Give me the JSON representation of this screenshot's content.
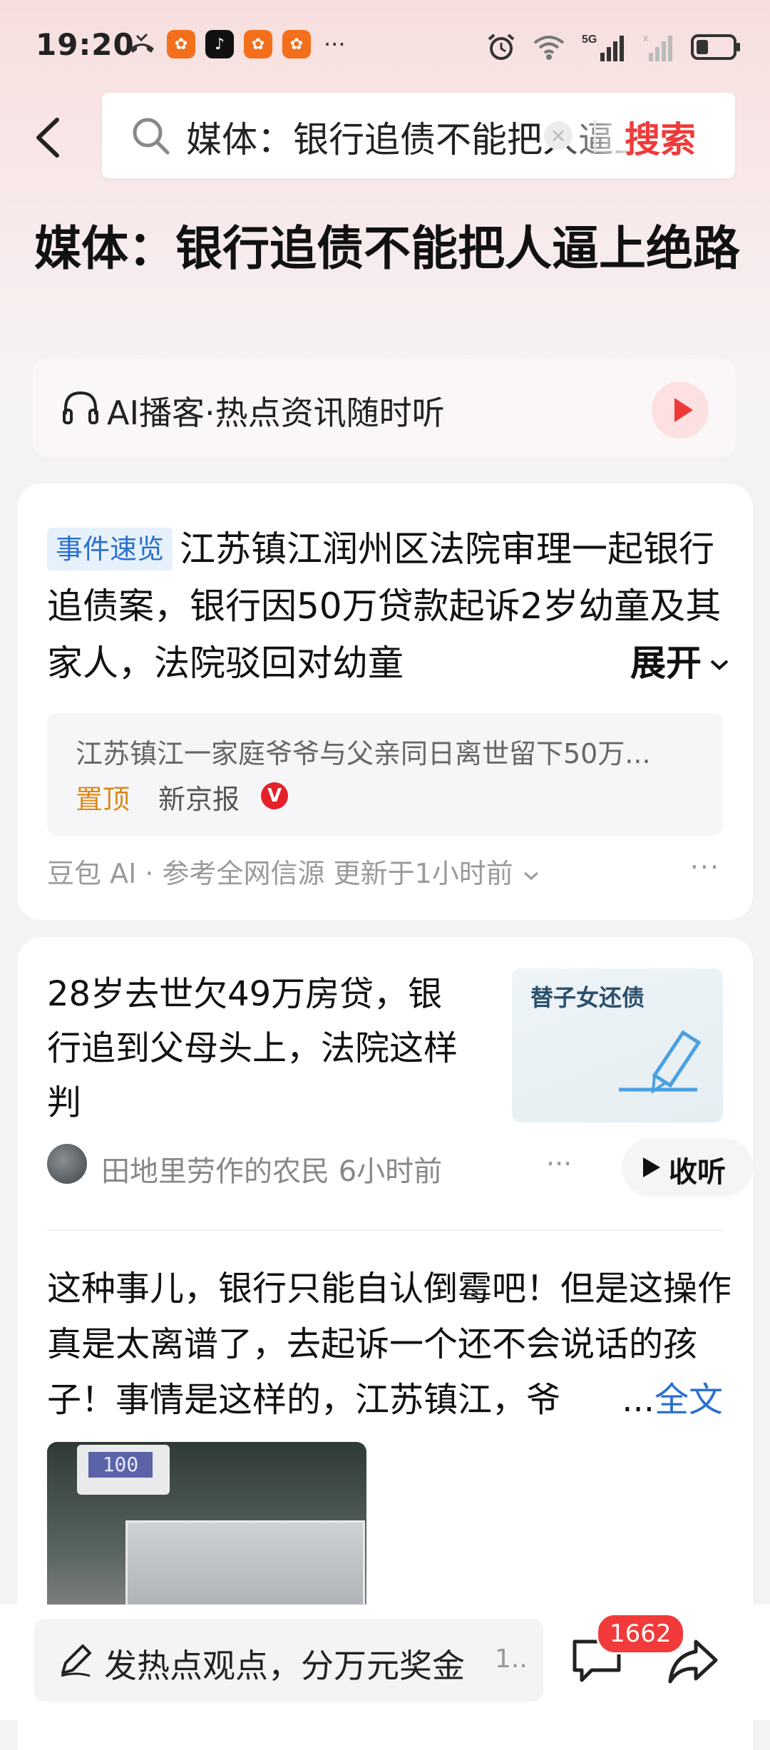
{
  "status_bar": {
    "time": "19:20",
    "icons": [
      "missed-call-icon",
      "app-icon",
      "tiktok-icon",
      "app-icon",
      "app-icon",
      "more-dots",
      "alarm-icon",
      "wifi-icon",
      "5g-signal-icon",
      "signal-icon",
      "battery-icon"
    ],
    "more": "···",
    "network": "5G"
  },
  "nav": {
    "search_query": "媒体：银行追债不能把人逼上绝路",
    "clear_label": "×",
    "search_button": "搜索"
  },
  "headline": "媒体：银行追债不能把人逼上绝路",
  "podcast": {
    "label": "AI播客·热点资讯随时听"
  },
  "summary_card": {
    "tag": "事件速览",
    "text": "江苏镇江润州区法院审理一起银行追债案，银行因50万贷款起诉2岁幼童及其家人，法院驳回对幼童",
    "expand_label": "展开",
    "reference": {
      "text": "江苏镇江一家庭爷爷与父亲同日离世留下50万...",
      "pin_label": "置顶",
      "source": "新京报",
      "verified": "V"
    },
    "meta": "豆包 AI · 参考全网信源 更新于1小时前",
    "more": "···"
  },
  "article": {
    "title": "28岁去世欠49万房贷，银行追到父母头上，法院这样判",
    "thumbnail_caption": "替子女还债",
    "author": "田地里劳作的农民",
    "time": "6小时前",
    "more": "···",
    "listen_label": "收听"
  },
  "post": {
    "text": "这种事儿，银行只能自认倒霉吧！但是这操作真是太离谱了，去起诉一个还不会说话的孩子！事情是这样的，江苏镇江，爷",
    "fulltext_prefix": "...",
    "fulltext_label": "全文",
    "photo_display": "100"
  },
  "bottom_bar": {
    "composer_placeholder": "发热点观点，分万元奖金",
    "composer_suffix": "1..",
    "comment_count": "1662"
  },
  "colors": {
    "accent_red": "#ee3a3a",
    "link_blue": "#2a6fd0",
    "pin_orange": "#d98a1a"
  }
}
